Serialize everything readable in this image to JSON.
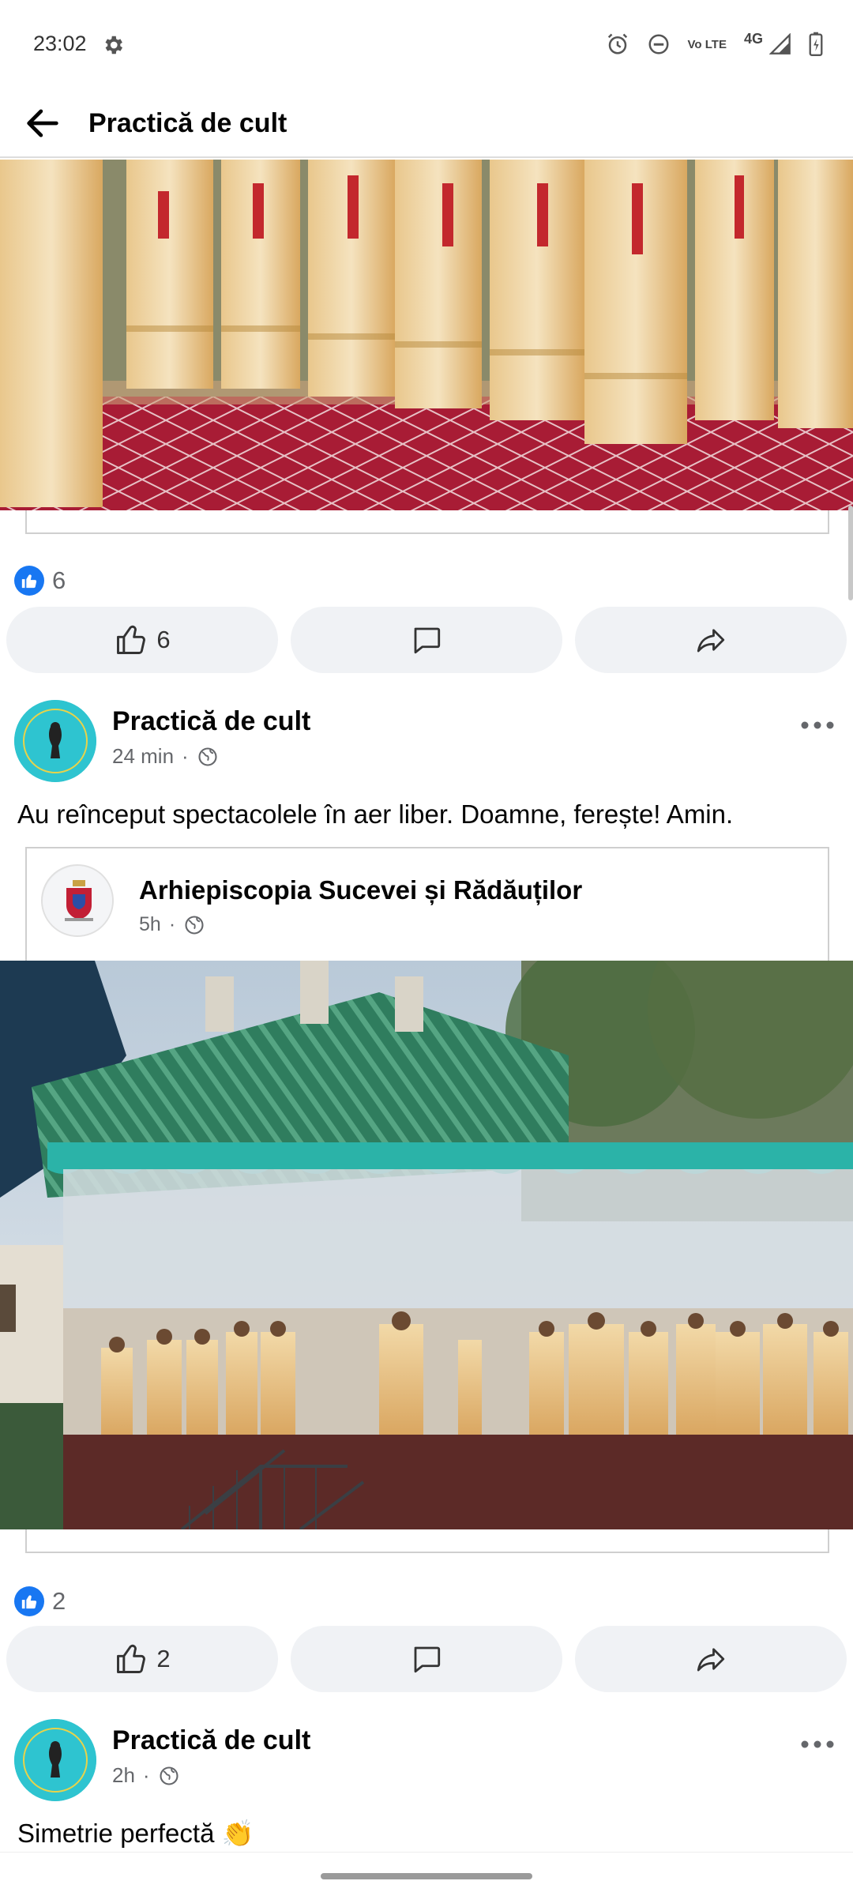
{
  "status_bar": {
    "time": "23:02",
    "network": "4G",
    "volte_label": "Vo LTE",
    "icons": [
      "gear-icon",
      "alarm-icon",
      "dnd-icon",
      "volte-icon",
      "signal-icon",
      "battery-icon"
    ]
  },
  "app_bar": {
    "title": "Practică de cult",
    "back_icon": "arrow-left-icon"
  },
  "posts": [
    {
      "image_caption_icon": "clergy-procession-photo",
      "reaction_count": "6",
      "like_count": "6",
      "comment_icon": "comment-icon",
      "share_icon": "share-icon"
    },
    {
      "author": "Practică de cult",
      "time": "24 min",
      "separator": "·",
      "audience_icon": "globe-icon",
      "text": "Au reînceput spectacolele în aer liber. Doamne, ferește! Amin.",
      "shared": {
        "author": "Arhiepiscopia Sucevei și Rădăuților",
        "time": "5h",
        "separator": "·",
        "audience_icon": "globe-icon",
        "image_icon": "outdoor-liturgy-photo"
      },
      "reaction_count": "2",
      "like_count": "2"
    },
    {
      "author": "Practică de cult",
      "time": "2h",
      "separator": "·",
      "audience_icon": "globe-icon",
      "text": "Simetrie perfectă 👏"
    }
  ],
  "colors": {
    "accent_blue": "#1877f2",
    "button_bg": "#f0f2f5",
    "meta_gray": "#65676b",
    "avatar_teal": "#2ec4d0"
  }
}
